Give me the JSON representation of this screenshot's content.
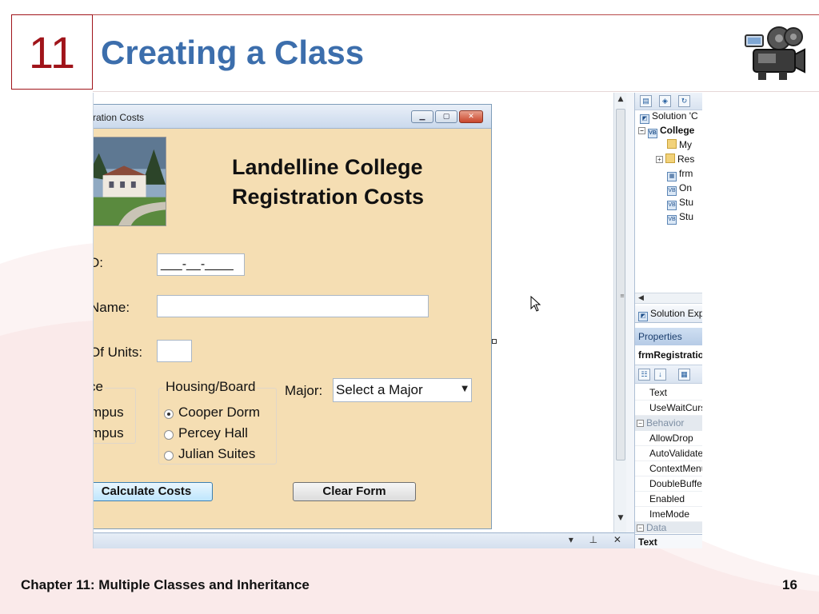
{
  "slide": {
    "chapter_number": "11",
    "title": "Creating a Class",
    "footer_text": "Chapter 11: Multiple Classes and Inheritance",
    "page_number": "16",
    "accent_color": "#a0141a",
    "title_color": "#3c6eac"
  },
  "form": {
    "window_title": "ration Costs",
    "heading_line1": "Landelline College",
    "heading_line2": "Registration Costs",
    "id_label": "D:",
    "id_mask": "___-__-____",
    "name_label": "Name:",
    "units_label": "Of Units:",
    "residence_group_label": "ce",
    "residence_options": [
      "mpus",
      "mpus"
    ],
    "housing_group_label": "Housing/Board",
    "housing_options": [
      "Cooper Dorm",
      "Percey Hall",
      "Julian Suites"
    ],
    "housing_selected": 0,
    "major_label": "Major:",
    "major_value": "Select a Major",
    "calculate_button": "Calculate Costs",
    "clear_button": "Clear Form",
    "background_color": "#f5deb3"
  },
  "solution_explorer": {
    "root": "Solution 'C",
    "project": "College",
    "items": [
      "My",
      "Res",
      "frm",
      "On",
      "Stu",
      "Stu"
    ],
    "tab_label": "Solution Expl"
  },
  "properties": {
    "header": "Properties",
    "object": "frmRegistration",
    "rows_top": [
      "Text",
      "UseWaitCurso"
    ],
    "category_behavior": "Behavior",
    "rows_behavior": [
      "AllowDrop",
      "AutoValidate",
      "ContextMenu",
      "DoubleBuffer",
      "Enabled",
      "ImeMode"
    ],
    "category_data": "Data",
    "description": "Text"
  },
  "icons": {
    "camera": "camera-icon",
    "cursor": "mouse-pointer-icon"
  }
}
